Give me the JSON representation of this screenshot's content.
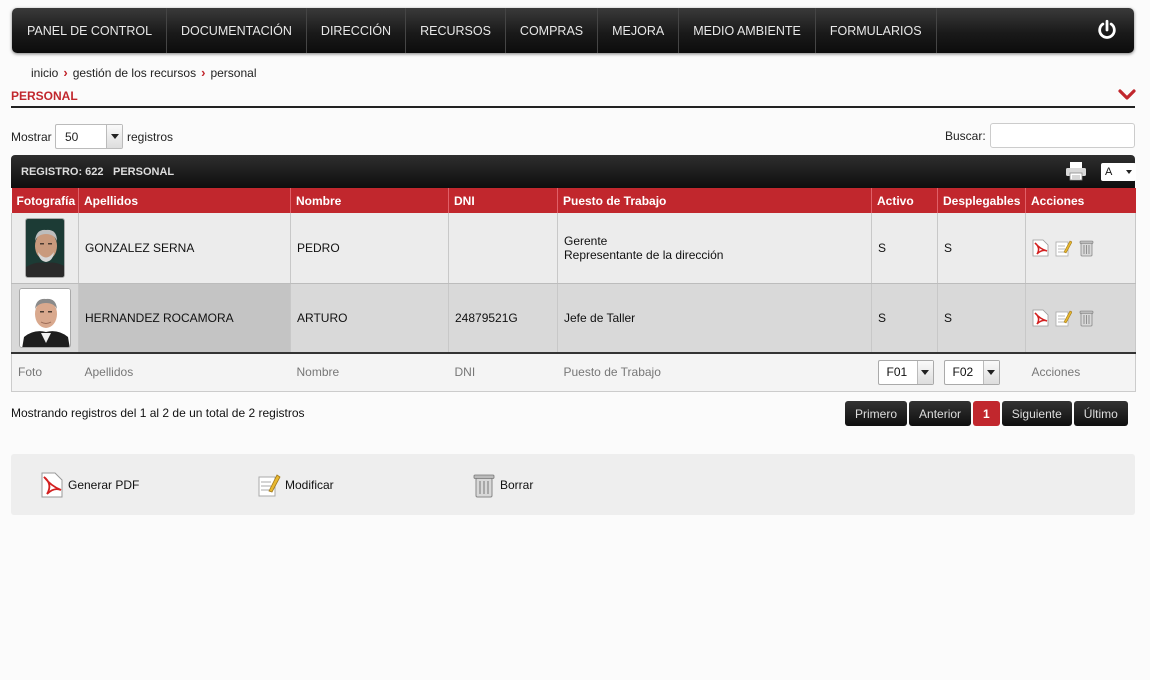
{
  "nav": {
    "items": [
      "PANEL DE CONTROL",
      "DOCUMENTACIÓN",
      "DIRECCIÓN",
      "RECURSOS",
      "COMPRAS",
      "MEJORA",
      "MEDIO AMBIENTE",
      "FORMULARIOS"
    ],
    "power_icon": "power-icon"
  },
  "breadcrumb": [
    "inicio",
    "gestión de los recursos",
    "personal"
  ],
  "section": {
    "title": "PERSONAL",
    "collapse_icon": "chevron-down-icon"
  },
  "controls": {
    "show_label": "Mostrar",
    "show_value": "50",
    "records_label": "registros",
    "search_label": "Buscar:",
    "search_value": ""
  },
  "toolbar": {
    "registro": "REGISTRO: 622",
    "personal": "PERSONAL",
    "print_icon": "printer-icon",
    "font_value": "A"
  },
  "table": {
    "headers": [
      "Fotografía",
      "Apellidos",
      "Nombre",
      "DNI",
      "Puesto de Trabajo",
      "Activo",
      "Desplegables",
      "Acciones"
    ],
    "rows": [
      {
        "apellidos": "GONZALEZ SERNA",
        "nombre": "PEDRO",
        "dni": "",
        "puesto1": "Gerente",
        "puesto2": "Representante de la dirección",
        "activo": "S",
        "desplegables": "S"
      },
      {
        "apellidos": "HERNANDEZ ROCAMORA",
        "nombre": "ARTURO",
        "dni": "24879521G",
        "puesto1": "Jefe de Taller",
        "puesto2": "",
        "activo": "S",
        "desplegables": "S"
      }
    ],
    "footer": {
      "foto": "Foto",
      "apellidos": "Apellidos",
      "nombre": "Nombre",
      "dni": "DNI",
      "puesto": "Puesto de Trabajo",
      "f1": "F01",
      "f2": "F02",
      "acciones": "Acciones"
    }
  },
  "info": "Mostrando registros del 1 al 2 de un total de 2 registros",
  "pager": {
    "first": "Primero",
    "prev": "Anterior",
    "current": "1",
    "next": "Siguiente",
    "last": "Último"
  },
  "legend": {
    "pdf": "Generar PDF",
    "edit": "Modificar",
    "delete": "Borrar"
  },
  "colors": {
    "accent": "#c1272d",
    "nav_bg": "#1a1a1a"
  }
}
